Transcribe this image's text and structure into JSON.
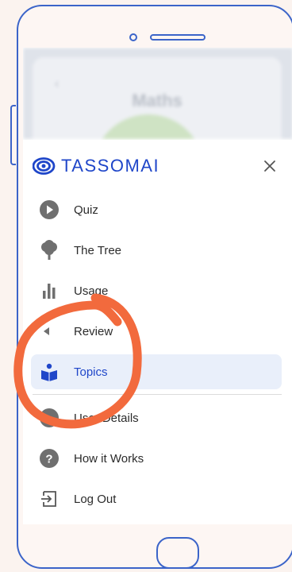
{
  "background_app": {
    "title": "Maths"
  },
  "drawer": {
    "brand": "TASSOMAI",
    "items": [
      {
        "label": "Quiz",
        "icon": "play-icon"
      },
      {
        "label": "The Tree",
        "icon": "tree-icon"
      },
      {
        "label": "Usage",
        "icon": "bar-chart-icon"
      },
      {
        "label": "Review",
        "icon": "review-icon"
      },
      {
        "label": "Topics",
        "icon": "book-icon",
        "active": true
      },
      {
        "label": "User Details",
        "icon": "user-icon"
      },
      {
        "label": "How it Works",
        "icon": "help-icon"
      },
      {
        "label": "Log Out",
        "icon": "logout-icon"
      }
    ]
  },
  "colors": {
    "brand": "#1f46c9",
    "active_bg": "#e9effa",
    "annotation": "#f26a3d",
    "device_outline": "#3b64c9"
  }
}
